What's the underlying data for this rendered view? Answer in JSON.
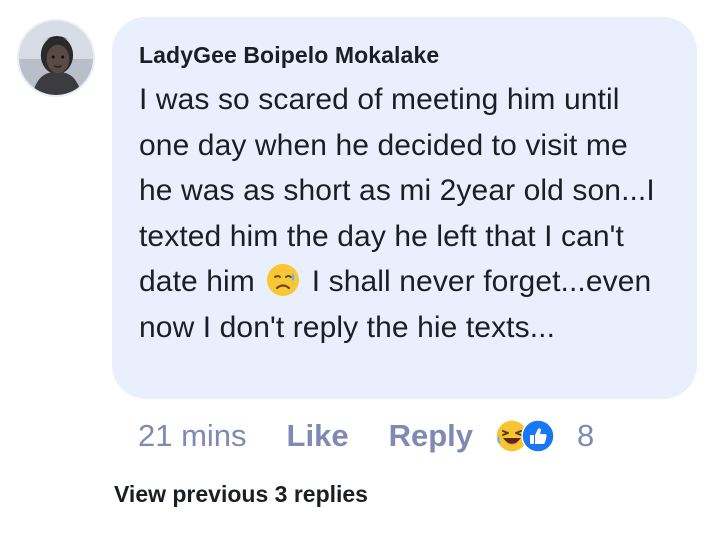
{
  "comment": {
    "author": "LadyGee Boipelo Mokalake",
    "text_before_emoji": "I was so scared of meeting him until one day when he decided to visit me he was as short as mi 2year old son...I texted him the day he left that I can't date him ",
    "inline_emoji": "sad-but-relieved-face",
    "text_after_emoji": " I shall never forget...even now I don't reply the hie texts...",
    "time": "21 mins",
    "like_label": "Like",
    "reply_label": "Reply",
    "reaction_count": "8",
    "reactions": [
      "laughing-face",
      "thumbs-up-like"
    ]
  },
  "thread": {
    "view_previous_label": "View previous 3 replies"
  },
  "colors": {
    "bubble_bg": "#e9effc",
    "action_text": "#7f8ab3",
    "like_blue": "#1877f2",
    "laugh_yellow": "#f7c531"
  }
}
